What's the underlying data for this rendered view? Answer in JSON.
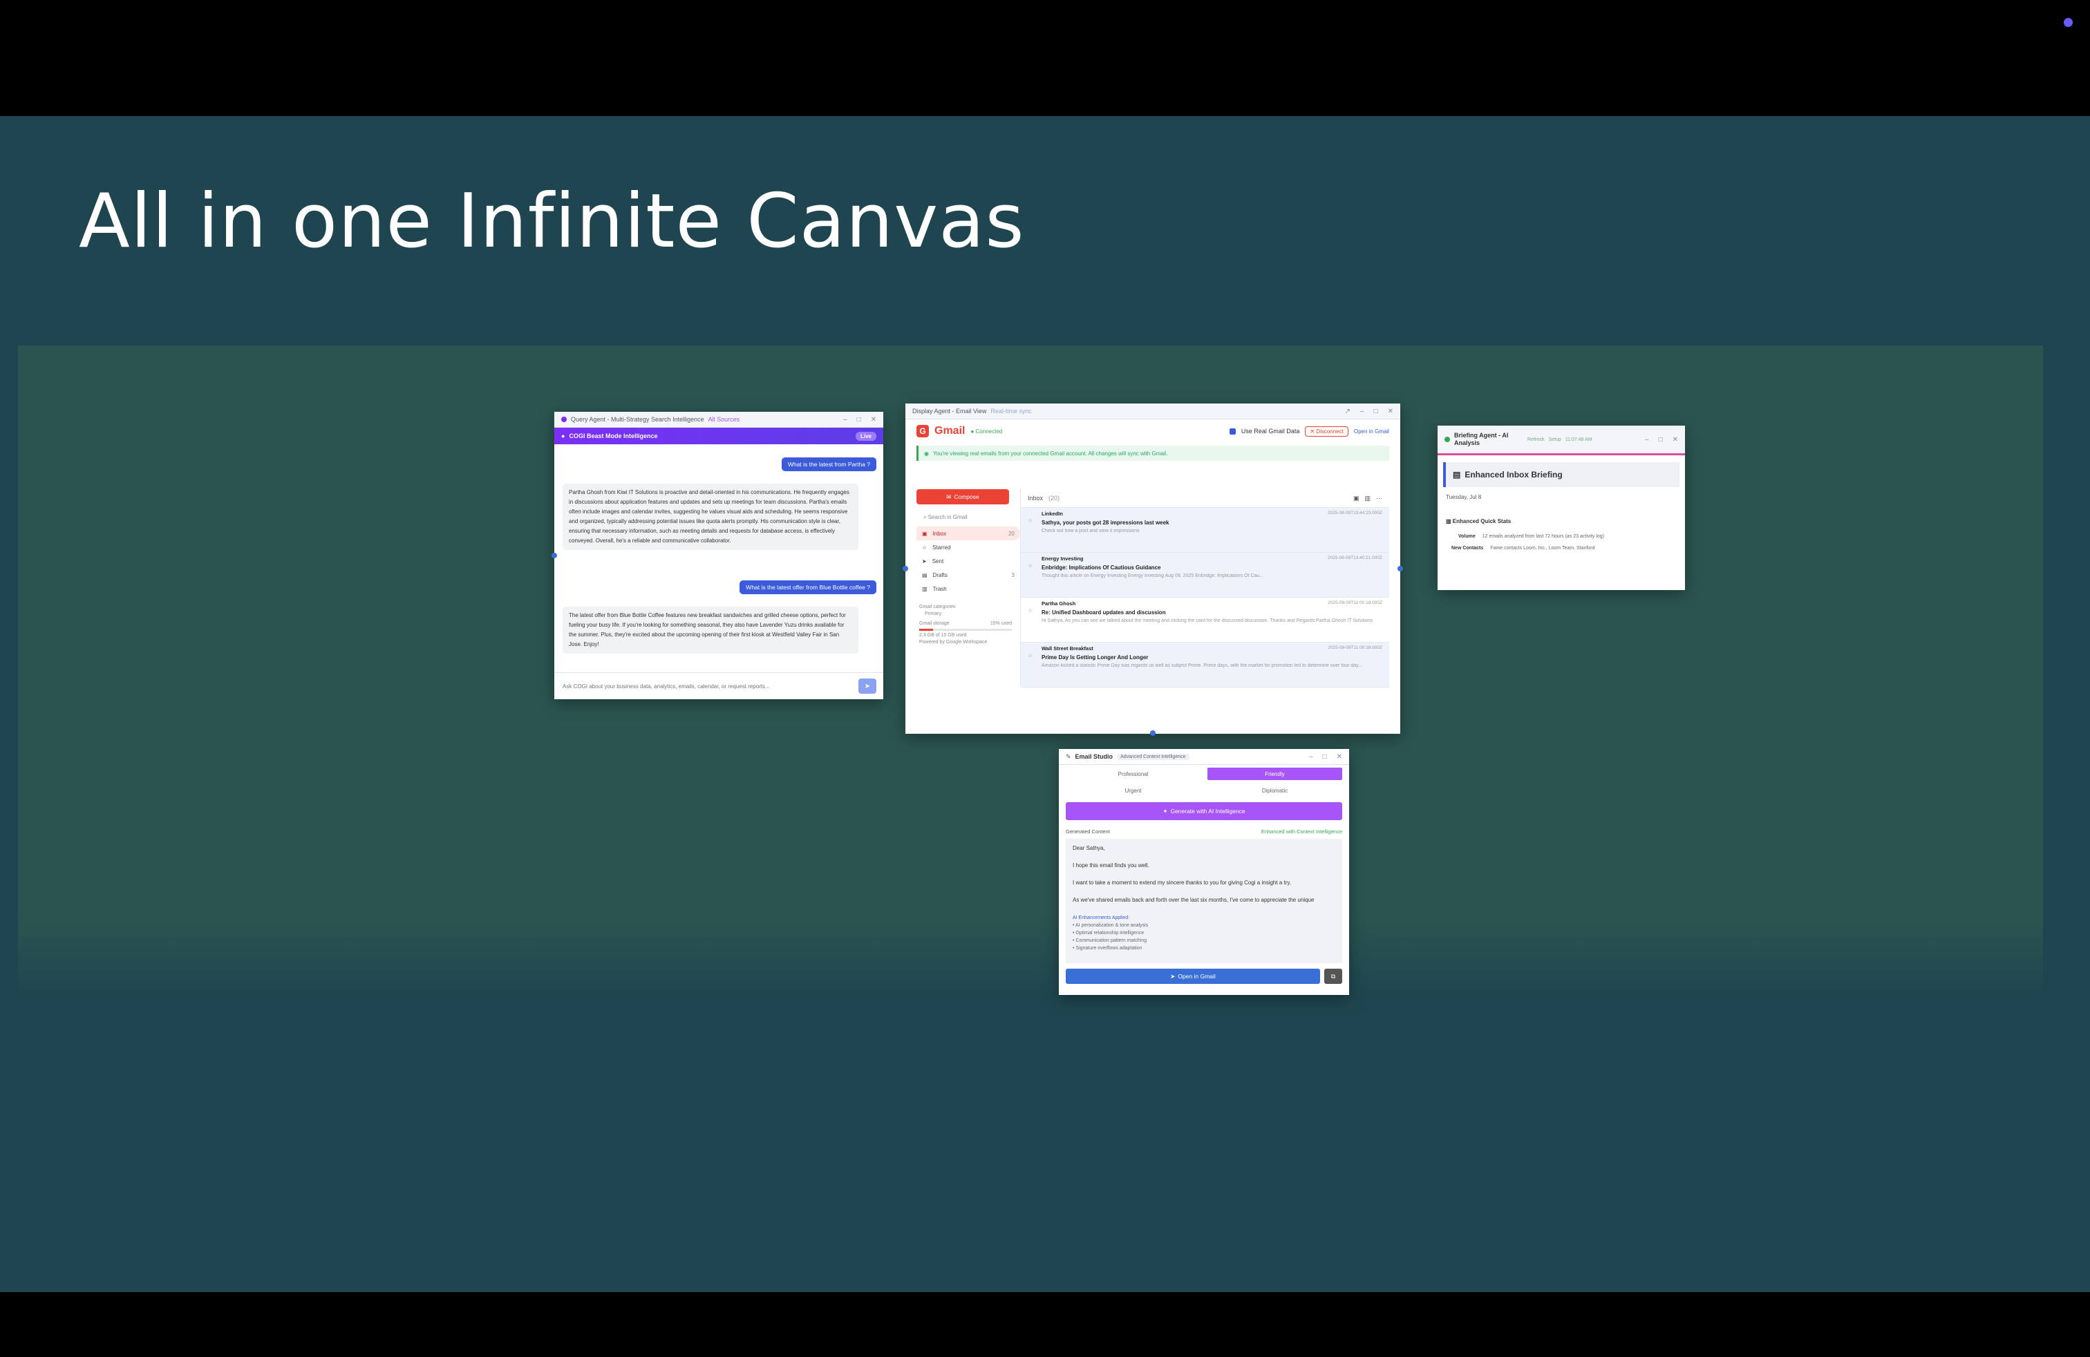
{
  "slide": {
    "title": "All in one Infinite Canvas"
  },
  "chat": {
    "window_title": "Query Agent - Multi-Strategy Search Intelligence",
    "badge": "All Sources",
    "header": "COGI Beast Mode Intelligence",
    "header_pill": "Live",
    "q1": "What is the latest from Partha ?",
    "a1": "Partha Ghosh from Kiwi IT Solutions is proactive and detail-oriented in his communications. He frequently engages in discussions about application features and updates and sets up meetings for team discussions. Partha's emails often include images and calendar invites, suggesting he values visual aids and scheduling. He seems responsive and organized, typically addressing potential issues like quota alerts promptly. His communication style is clear, ensuring that necessary information, such as meeting details and requests for database access, is effectively conveyed. Overall, he's a reliable and communicative collaborator.",
    "q2": "What is the latest offer from Blue Bottle coffee ?",
    "a2": "The latest offer from Blue Bottle Coffee features new breakfast sandwiches and grilled cheese options, perfect for fueling your busy life. If you're looking for something seasonal, they also have Lavender Yuzu drinks available for the summer. Plus, they're excited about the upcoming opening of their first kiosk at Westfield Valley Fair in San Jose. Enjoy!",
    "input_placeholder": "Ask COGI about your business data, analytics, emails, calendar, or request reports..."
  },
  "gmail": {
    "window_title": "Display Agent - Email View",
    "window_status": "Real-time sync",
    "brand": "Gmail",
    "status": "● Connected",
    "use_real": "Use Real Gmail Data",
    "disconnect": "✕ Disconnect",
    "open_in_gmail": "Open in Gmail",
    "banner": "You're viewing real emails from your connected Gmail account. All changes will sync with Gmail.",
    "compose": "Compose",
    "search_placeholder": "Search in Gmail",
    "nav": [
      {
        "label": "Inbox",
        "count": "20",
        "icon": "inbox-icon"
      },
      {
        "label": "Starred",
        "count": "",
        "icon": "star-icon"
      },
      {
        "label": "Sent",
        "count": "",
        "icon": "send-icon"
      },
      {
        "label": "Drafts",
        "count": "3",
        "icon": "draft-icon"
      },
      {
        "label": "Trash",
        "count": "",
        "icon": "trash-icon"
      }
    ],
    "categories_label": "Gmail categories",
    "categories_item": "Primary",
    "storage_label": "Gmail storage",
    "storage_value": "15% used",
    "storage_fraction": 0.15,
    "storage_detail": "2.3 GB of 15 GB used",
    "powered": "Powered by Google Workspace",
    "list_header": "Inbox",
    "list_count": "(20)",
    "emails": [
      {
        "from": "LinkedIn",
        "date": "2025-08-09T13:44:23.000Z",
        "subject": "Sathya, your posts got 28 impressions last week",
        "preview": "Check out how a post and view it impressions",
        "read": false
      },
      {
        "from": "Energy Investing",
        "date": "2025-08-09T13:40:21.000Z",
        "subject": "Enbridge: Implications Of Cautious Guidance",
        "preview": "Thought this article on Energy Investing Energy Investing Aug 09, 2025 Enbridge: Implications Of Cau...",
        "read": false
      },
      {
        "from": "Partha Ghosh",
        "date": "2025-08-09T11:00:18.000Z",
        "subject": "Re: Unified Dashboard updates and discussion",
        "preview": "Hi Sathya, As you can see we talked about the meeting and clicking the card for the discussed discussion. Thanks and Regards Partha Ghosh IT Solutions",
        "read": true
      },
      {
        "from": "Wall Street Breakfast",
        "date": "2025-08-09T11:00:18.000Z",
        "subject": "Prime Day Is Getting Longer And Longer",
        "preview": "Amazon kicked a statistic Prime Day was regards us well as subject Prime. Prime days, with the market for promotion led to determine over four day...",
        "read": false
      }
    ]
  },
  "brief": {
    "window_title": "Briefing Agent - AI Analysis",
    "refresh": "Refresh",
    "settings": "Setup",
    "time": "11:07:48 AM",
    "card_title": "Enhanced Inbox Briefing",
    "date": "Tuesday, Jul 8",
    "quick_title": "Enhanced Quick Stats",
    "stat1_label": "Volume",
    "stat1_value": "12 emails analyzed from last 72 hours (as 23 activity log)",
    "stat2_label": "New Contacts",
    "stat2_value": "Fame contacts Loom, Inc., Loom Team, Stanford"
  },
  "studio": {
    "window_title": "Email Studio",
    "tag": "Advanced Context Intelligence",
    "tones": [
      "Professional",
      "Friendly",
      "Urgent",
      "Diplomatic"
    ],
    "selected_tone": 1,
    "generate": "Generate with AI Intelligence",
    "generated_label": "Generated Content",
    "generated_status": "Enhanced with Context Intelligence",
    "greeting": "Dear Sathya,",
    "line1": "I hope this email finds you well.",
    "line2": "I want to take a moment to extend my sincere thanks to you for giving Cogi a insight a try.",
    "line3": "As we've shared emails back and forth over the last six months, I've come to appreciate the unique",
    "enh_title": "AI Enhancements Applied:",
    "enh_items": [
      "• AI personalization & tone analysis",
      "• Optimal relationship intelligence",
      "• Communication pattern matching",
      "• Signature overflows adaptation"
    ],
    "open": "Open in Gmail"
  }
}
